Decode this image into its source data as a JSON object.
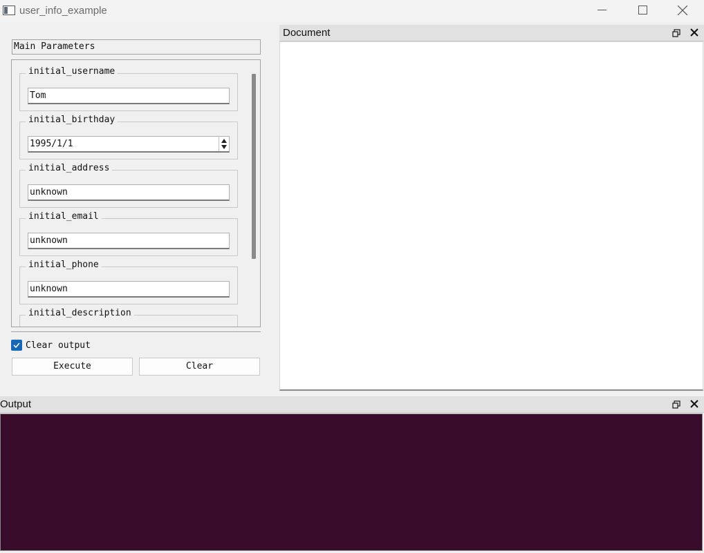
{
  "window": {
    "title": "user_info_example",
    "controls": [
      "minimize-icon",
      "maximize-icon",
      "close-icon"
    ]
  },
  "params": {
    "header": "Main Parameters",
    "fields": [
      {
        "label": "initial_username",
        "value": "Tom"
      },
      {
        "label": "initial_birthday",
        "value": "1995/1/1"
      },
      {
        "label": "initial_address",
        "value": "unknown"
      },
      {
        "label": "initial_email",
        "value": "unknown"
      },
      {
        "label": "initial_phone",
        "value": "unknown"
      },
      {
        "label": "initial_description",
        "value": ""
      }
    ]
  },
  "controls": {
    "clear_output_label": "Clear output",
    "clear_output_checked": true,
    "execute_label": "Execute",
    "clear_label": "Clear"
  },
  "docks": {
    "document_title": "Document",
    "output_title": "Output"
  },
  "colors": {
    "output_bg": "#380c2a",
    "checkbox_accent": "#1667b7"
  }
}
